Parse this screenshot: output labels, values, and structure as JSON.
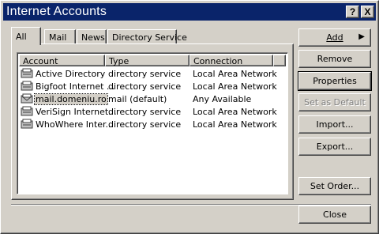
{
  "window": {
    "title": "Internet Accounts",
    "help_glyph": "?",
    "close_glyph": "X"
  },
  "tabs": [
    {
      "label": "All",
      "active": true
    },
    {
      "label": "Mail",
      "active": false
    },
    {
      "label": "News",
      "active": false
    },
    {
      "label": "Directory Service",
      "active": false
    }
  ],
  "list": {
    "columns": [
      "Account",
      "Type",
      "Connection"
    ],
    "rows": [
      {
        "account": "Active Directory",
        "type": "directory service",
        "connection": "Local Area Network",
        "icon": "directory-service-icon"
      },
      {
        "account": "Bigfoot Internet ...",
        "type": "directory service",
        "connection": "Local Area Network",
        "icon": "directory-service-icon"
      },
      {
        "account": "mail.domeniu.ro",
        "type": "mail (default)",
        "connection": "Any Available",
        "icon": "mail-account-icon",
        "selected": true
      },
      {
        "account": "VeriSign Internet...",
        "type": "directory service",
        "connection": "Local Area Network",
        "icon": "directory-service-icon"
      },
      {
        "account": "WhoWhere Inter...",
        "type": "directory service",
        "connection": "Local Area Network",
        "icon": "directory-service-icon"
      }
    ]
  },
  "buttons": {
    "add": "Add",
    "remove": "Remove",
    "properties": "Properties",
    "set_default": "Set as Default",
    "import": "Import...",
    "export": "Export...",
    "set_order": "Set Order...",
    "close": "Close"
  },
  "colors": {
    "titlebar": "#0a246a",
    "face": "#d4d0c8"
  }
}
